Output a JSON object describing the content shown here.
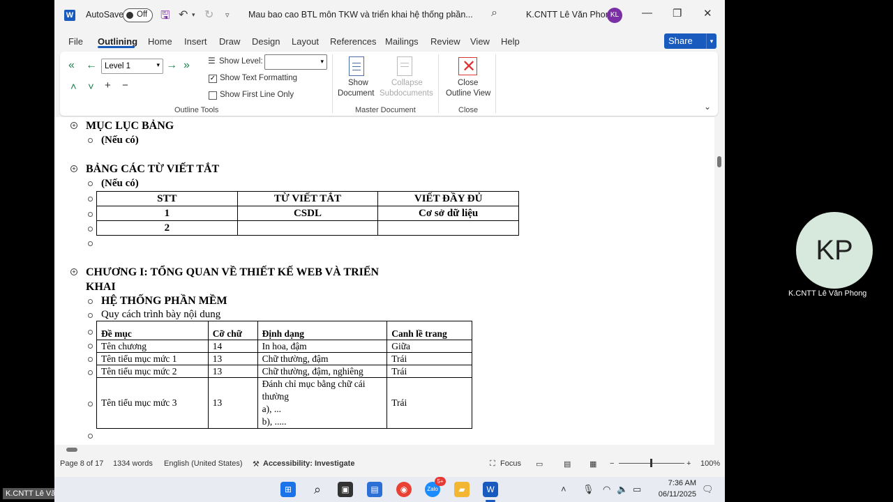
{
  "app": {
    "autosave_label": "AutoSave",
    "autosave_state": "Off",
    "doc_title": "Mau bao cao BTL môn TKW và triển khai hệ thống phần...",
    "user_name": "K.CNTT Lê Văn Phong",
    "user_initials": "KL"
  },
  "tabs": [
    "File",
    "Outlining",
    "Home",
    "Insert",
    "Draw",
    "Design",
    "Layout",
    "References",
    "Mailings",
    "Review",
    "View",
    "Help"
  ],
  "share_label": "Share",
  "ribbon": {
    "level_value": "Level 1",
    "show_level_label": "Show Level:",
    "show_text_formatting": "Show Text Formatting",
    "show_first_line_only": "Show First Line Only",
    "outline_tools_group": "Outline Tools",
    "show_document_1": "Show",
    "show_document_2": "Document",
    "collapse_1": "Collapse",
    "collapse_2": "Subdocuments",
    "master_document_group": "Master Document",
    "close_1": "Close",
    "close_2": "Outline View",
    "close_group": "Close"
  },
  "document": {
    "h_tables": "MỤC LỤC BẢNG",
    "note1": "(Nếu có)",
    "h_abbr": "BẢNG CÁC TỪ VIẾT TẮT",
    "note2": "(Nếu có)",
    "abbr_table": {
      "headers": [
        "STT",
        "TỪ VIẾT TẮT",
        "VIẾT ĐẦY ĐỦ"
      ],
      "rows": [
        [
          "1",
          "CSDL",
          "Cơ sở dữ liệu"
        ],
        [
          "2",
          "",
          ""
        ]
      ]
    },
    "h_chapter_1": "CHƯƠNG I: TỔNG QUAN VỀ THIẾT KẾ WEB VÀ TRIỂN",
    "h_chapter_2": "KHAI",
    "h_system": "HỆ THỐNG PHẦN MỀM",
    "format_caption": "Quy cách trình bày nội dung",
    "format_table": {
      "headers": [
        "Đề mục",
        "Cỡ chữ",
        "Định dạng",
        "Canh lề trang"
      ],
      "rows": [
        [
          "Tên chương",
          "14",
          "In hoa, đậm",
          "Giữa"
        ],
        [
          "Tên tiểu mục mức 1",
          "13",
          "Chữ thường, đậm",
          "Trái"
        ],
        [
          "Tên tiểu mục mức 2",
          "13",
          "Chữ thường, đậm, nghiêng",
          "Trái"
        ]
      ],
      "last_row": {
        "c1": "Tên tiểu mục mức 3",
        "c2": "13",
        "c3_lines": [
          "Đánh chỉ mục bằng chữ cái",
          "thường",
          "a), ...",
          "b), ....."
        ],
        "c4": "Trái"
      }
    }
  },
  "status": {
    "page": "Page 8 of 17",
    "words": "1334 words",
    "language": "English (United States)",
    "accessibility": "Accessibility: Investigate",
    "focus": "Focus",
    "zoom": "100%"
  },
  "presenter": {
    "initials": "KP",
    "name": "K.CNTT Lê Văn Phong",
    "tag": "K.CNTT Lê Văn Phong"
  },
  "taskbar": {
    "time": "7:36 AM",
    "date": "06/11/2025",
    "zalo_badge": "5+"
  }
}
